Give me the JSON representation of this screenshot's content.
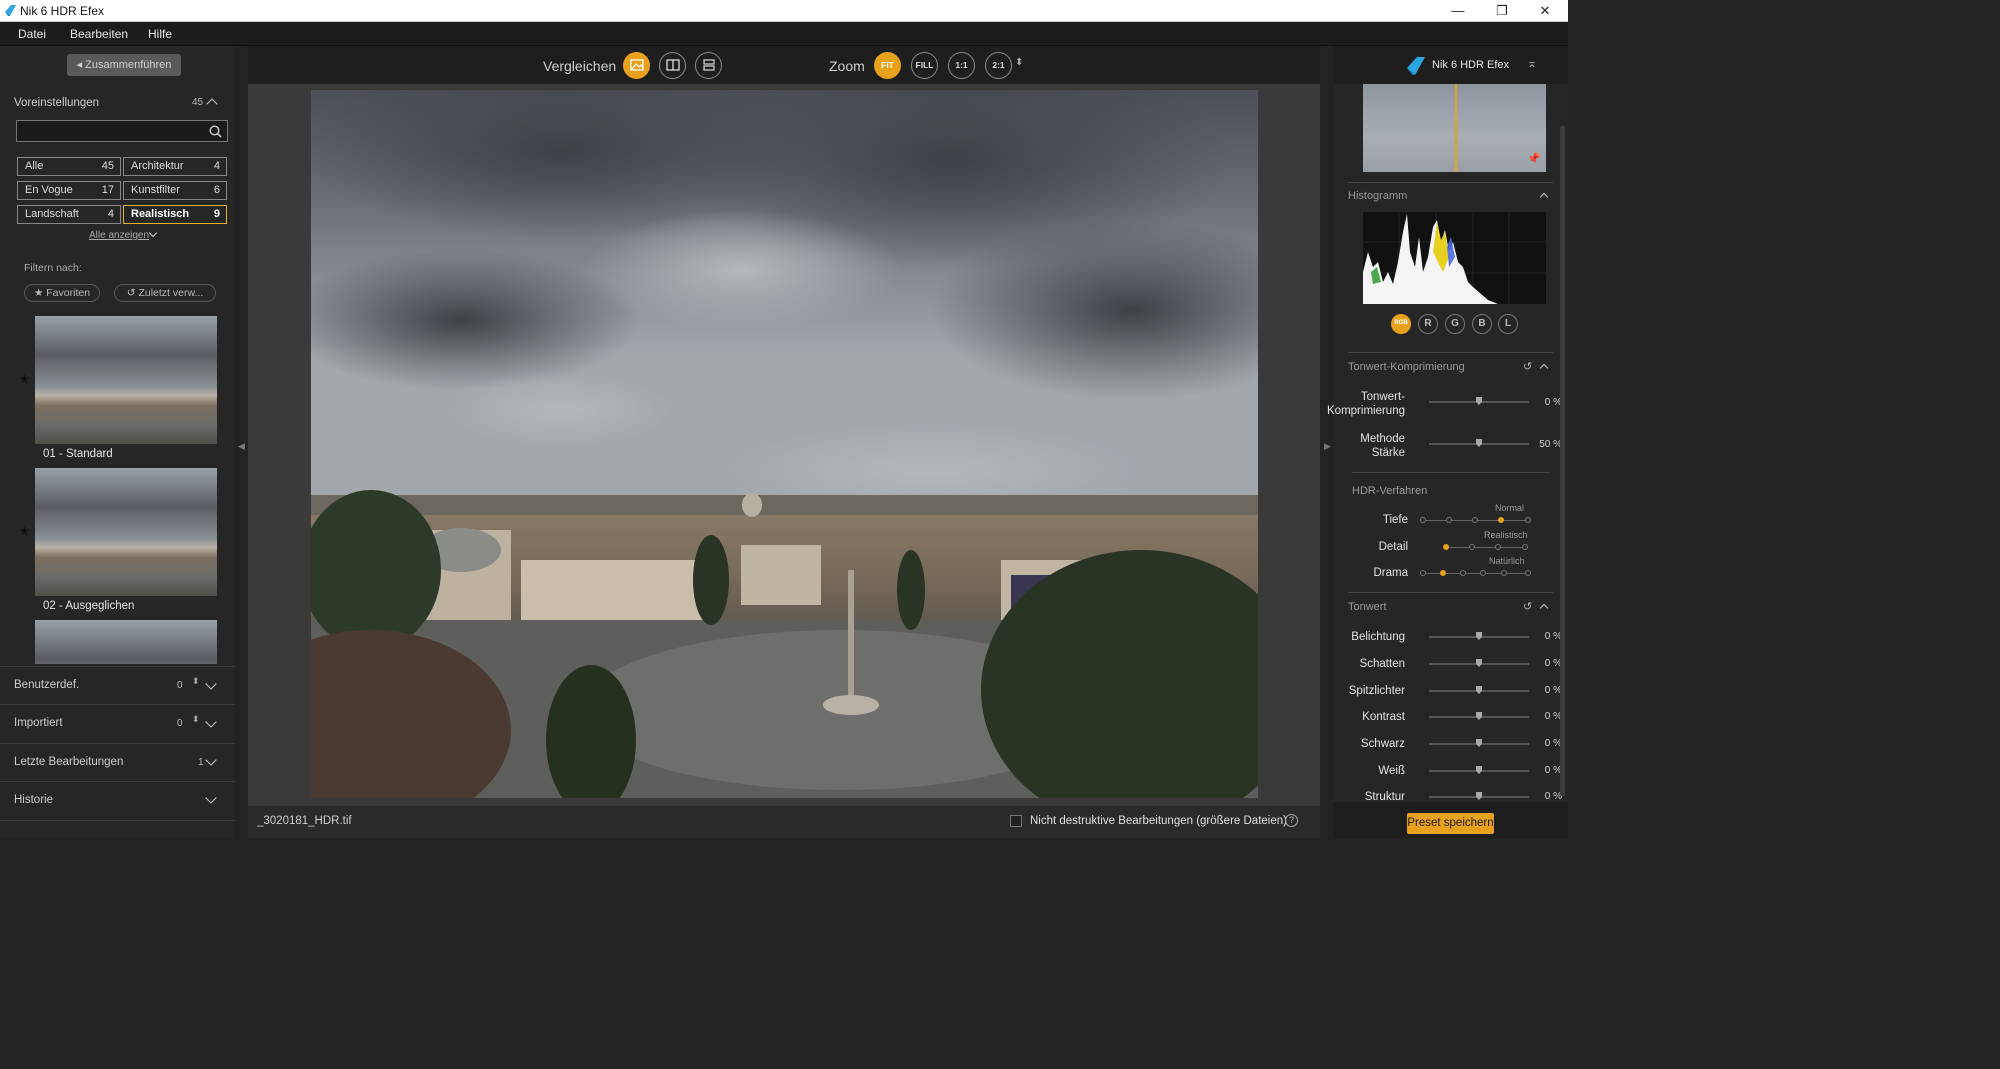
{
  "window": {
    "title": "Nik 6 HDR Efex"
  },
  "menu": [
    "Datei",
    "Bearbeiten",
    "Hilfe"
  ],
  "left": {
    "merge_label": "Zusammenführen",
    "presets": {
      "title": "Voreinstellungen",
      "count": "45"
    },
    "categories": [
      {
        "label": "Alle",
        "count": "45"
      },
      {
        "label": "Architektur",
        "count": "4"
      },
      {
        "label": "En Vogue",
        "count": "17"
      },
      {
        "label": "Kunstfilter",
        "count": "6"
      },
      {
        "label": "Landschaft",
        "count": "4"
      },
      {
        "label": "Realistisch",
        "count": "9"
      }
    ],
    "show_all": "Alle anzeigen",
    "filter_label": "Filtern nach:",
    "favorites": "★ Favoriten",
    "recent": "↺ Zuletzt verw...",
    "thumbnails": [
      {
        "label": "01 - Standard"
      },
      {
        "label": "02 - Ausgeglichen"
      }
    ],
    "sections": [
      {
        "label": "Benutzerdef.",
        "count": "0"
      },
      {
        "label": "Importiert",
        "count": "0"
      },
      {
        "label": "Letzte Bearbeitungen",
        "count": "1"
      },
      {
        "label": "Historie",
        "count": ""
      }
    ]
  },
  "toolbar": {
    "compare_label": "Vergleichen",
    "zoom_label": "Zoom",
    "zoom": [
      "FIT",
      "FILL",
      "1:1",
      "2:1"
    ]
  },
  "status": {
    "filename": "_3020181_HDR.tif",
    "nondestructive": "Nicht destruktive Bearbeitungen (größere Dateien)",
    "help": "?"
  },
  "right": {
    "title": "Nik 6 HDR Efex",
    "histogram": "Histogramm",
    "channels": [
      "RGB",
      "R",
      "G",
      "B",
      "L"
    ],
    "tone_compression": {
      "title": "Tonwert-Komprimierung",
      "rows": [
        {
          "label": "Tonwert-\nKomprimierung",
          "value": "0 %"
        },
        {
          "label": "Methode\nStärke",
          "value": "50 %"
        }
      ]
    },
    "hdr": {
      "title": "HDR-Verfahren",
      "rows": [
        {
          "label": "Tiefe",
          "note": "Normal",
          "position": 3
        },
        {
          "label": "Detail",
          "note": "Realistisch",
          "position": 1
        },
        {
          "label": "Drama",
          "note": "Natürlich",
          "position": 1
        }
      ]
    },
    "tone": {
      "title": "Tonwert",
      "rows": [
        {
          "label": "Belichtung",
          "value": "0 %"
        },
        {
          "label": "Schatten",
          "value": "0 %"
        },
        {
          "label": "Spitzlichter",
          "value": "0 %"
        },
        {
          "label": "Kontrast",
          "value": "0 %"
        },
        {
          "label": "Schwarz",
          "value": "0 %"
        },
        {
          "label": "Weiß",
          "value": "0 %"
        },
        {
          "label": "Struktur",
          "value": "0 %"
        }
      ]
    },
    "save_preset": "Preset speichern"
  },
  "colors": {
    "accent": "#e8a11c",
    "selected_border": "#e8b12a"
  }
}
